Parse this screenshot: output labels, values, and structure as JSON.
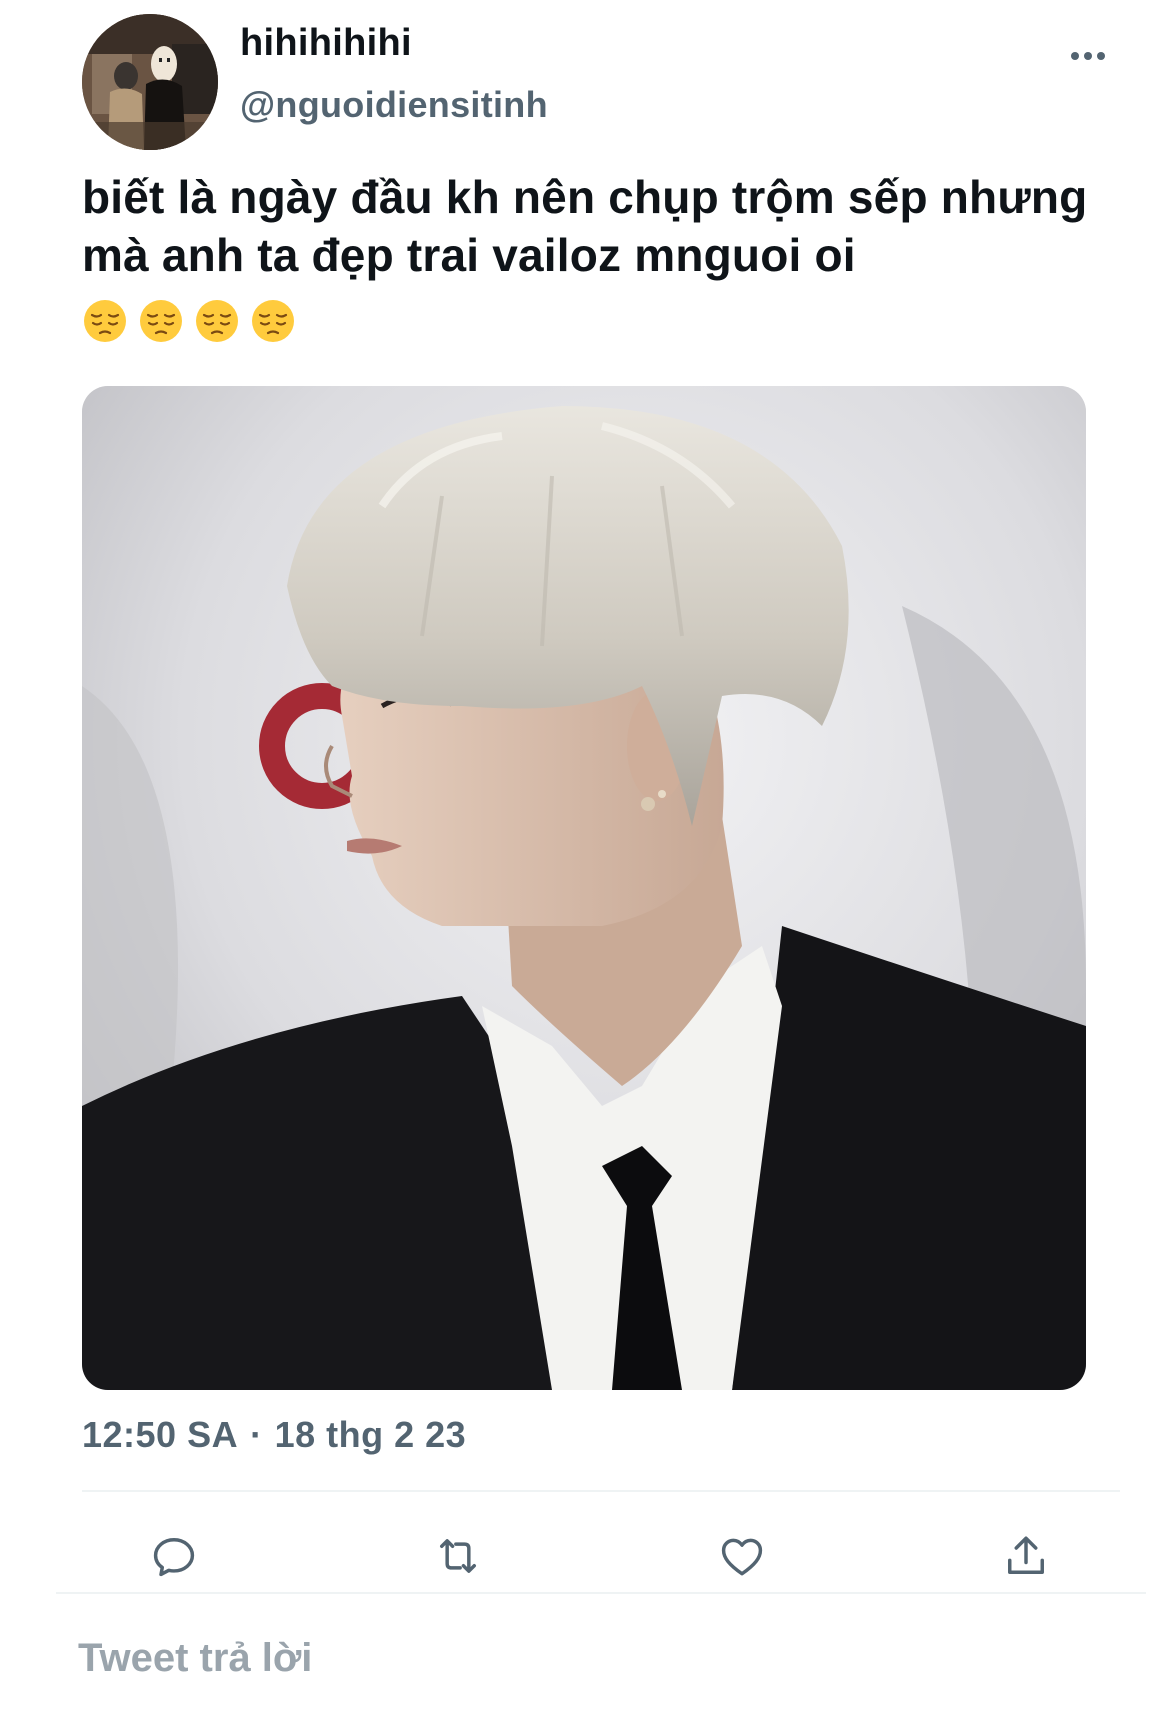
{
  "user": {
    "display_name": "hihihihihi",
    "handle": "@nguoidiensitinh",
    "avatar_icon": "profile-avatar"
  },
  "tweet": {
    "text": "biết là ngày đầu kh nên chụp trộm sếp nhưng mà anh ta đẹp trai vailoz mnguoi oi",
    "emoji": [
      "pensive-face-emoji",
      "pensive-face-emoji",
      "pensive-face-emoji",
      "pensive-face-emoji"
    ],
    "media_icon": "photo-man-platinum-hair-black-suit",
    "time": "12:50 SA",
    "separator": "·",
    "date": "18 thg 2 23"
  },
  "actions": {
    "more_icon": "more-horizontal-icon",
    "reply_icon": "reply-icon",
    "retweet_icon": "retweet-icon",
    "like_icon": "heart-icon",
    "share_icon": "share-icon"
  },
  "composer": {
    "placeholder": "Tweet trả lời",
    "value": ""
  },
  "colors": {
    "primary_text": "#0f1419",
    "secondary_text": "#536471",
    "divider": "#eff3f4",
    "icon": "#536471"
  }
}
